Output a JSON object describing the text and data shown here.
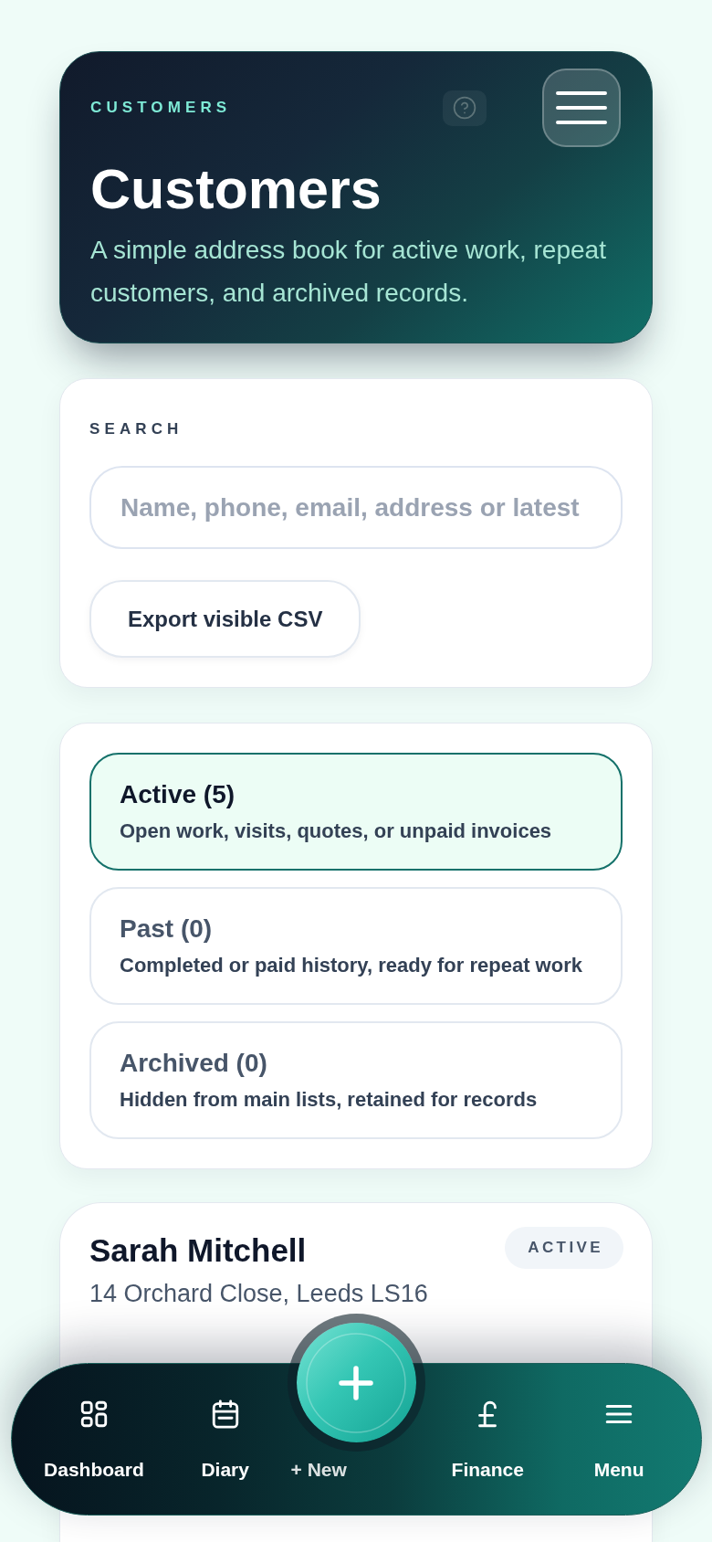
{
  "header": {
    "eyebrow": "CUSTOMERS",
    "title": "Customers",
    "subtitle": "A simple address book for active work, repeat customers, and archived records."
  },
  "search": {
    "label": "SEARCH",
    "placeholder": "Name, phone, email, address or latest",
    "export_button": "Export visible CSV"
  },
  "filters": [
    {
      "label": "Active (5)",
      "description": "Open work, visits, quotes, or unpaid invoices",
      "selected": true
    },
    {
      "label": "Past (0)",
      "description": "Completed or paid history, ready for repeat work",
      "selected": false
    },
    {
      "label": "Archived (0)",
      "description": "Hidden from main lists, retained for records",
      "selected": false
    }
  ],
  "customers": [
    {
      "name": "Sarah Mitchell",
      "status": "ACTIVE",
      "address": "14 Orchard Close, Leeds LS16"
    }
  ],
  "bottom_nav": [
    {
      "label": "Dashboard",
      "kind": "link"
    },
    {
      "label": "Diary",
      "kind": "link"
    },
    {
      "label": "+ New",
      "kind": "action"
    },
    {
      "label": "Finance",
      "kind": "link"
    },
    {
      "label": "Menu",
      "kind": "link"
    }
  ]
}
